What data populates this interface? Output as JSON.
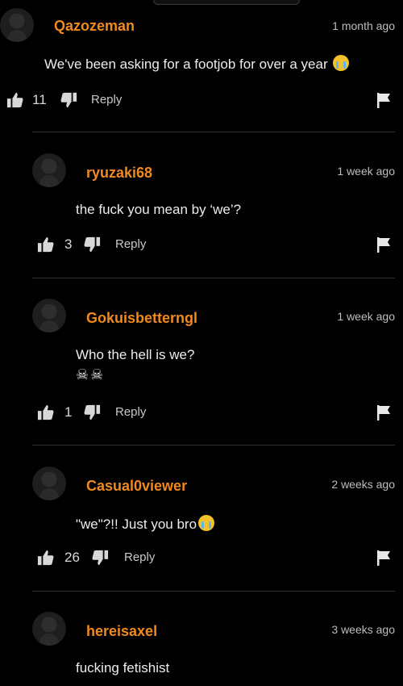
{
  "comments": [
    {
      "username": "Qazozeman",
      "time": "1 month ago",
      "text": "We've been asking for a footjob for over a year",
      "emoji": "loudly-crying-face",
      "likes": "11",
      "reply": "Reply"
    },
    {
      "username": "ryuzaki68",
      "time": "1 week ago",
      "text": "the fuck you mean by ‘we’?",
      "likes": "3",
      "reply": "Reply"
    },
    {
      "username": "Gokuisbetterngl",
      "time": "1 week ago",
      "text": "Who the hell is we?",
      "extra": "☠☠",
      "likes": "1",
      "reply": "Reply"
    },
    {
      "username": "Casual0viewer",
      "time": "2 weeks ago",
      "text": "\"we\"?!! Just you bro",
      "emoji": "loudly-crying-face",
      "likes": "26",
      "reply": "Reply"
    },
    {
      "username": "hereisaxel",
      "time": "3 weeks ago",
      "text": "fucking fetishist"
    }
  ],
  "colors": {
    "background": "#000000",
    "username": "#f08a1d",
    "text": "#ececec",
    "muted": "#bdbdbd",
    "divider": "#2e2e2e"
  }
}
